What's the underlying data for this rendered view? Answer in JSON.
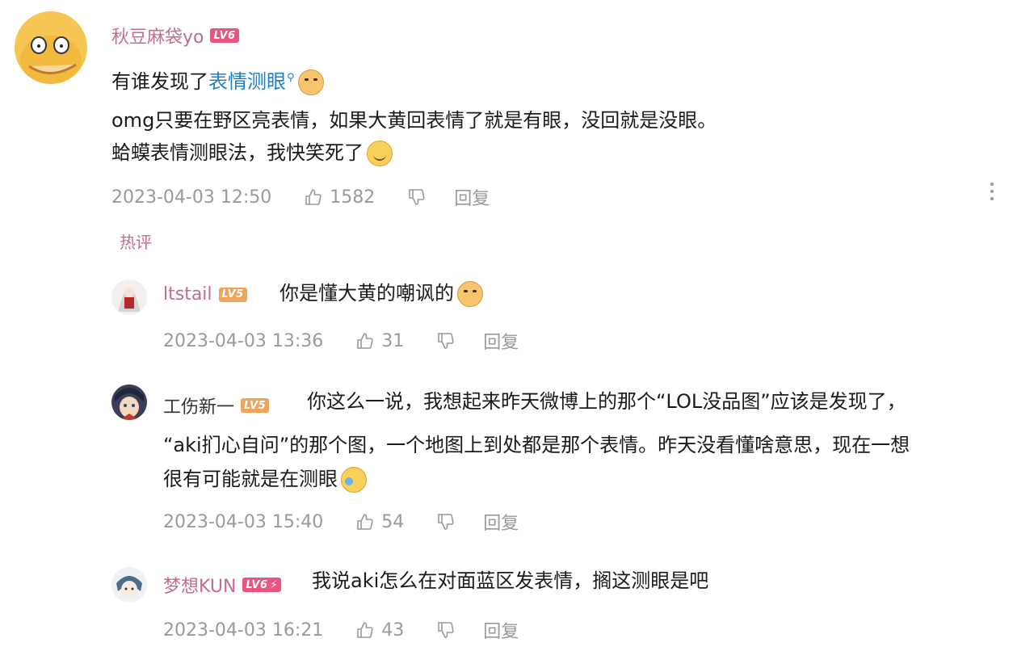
{
  "main_comment": {
    "username": "秋豆麻袋yo",
    "level": "LV6",
    "line1_prefix": "有谁发现了",
    "line1_link": "表情测眼",
    "line2": "omg只要在野区亮表情，如果大黄回表情了就是有眼，没回就是没眼。",
    "line3": "蛤蟆表情测眼法，我快笑死了",
    "timestamp": "2023-04-03 12:50",
    "likes": "1582",
    "reply_label": "回复"
  },
  "section_label": "热评",
  "replies": [
    {
      "username": "ltstail",
      "level": "LV5",
      "text": "你是懂大黄的嘲讽的",
      "timestamp": "2023-04-03 13:36",
      "likes": "31",
      "reply_label": "回复"
    },
    {
      "username": "工伤新一",
      "level": "LV5",
      "text_line1": "你这么一说，我想起来昨天微博上的那个“LOL没品图”应该是发现了，",
      "text_line2": "“aki扪心自问”的那个图，一个地图上到处都是那个表情。昨天没看懂啥意思，现在一想",
      "text_line3": "很有可能就是在测眼",
      "timestamp": "2023-04-03 15:40",
      "likes": "54",
      "reply_label": "回复"
    },
    {
      "username": "梦想KUN",
      "level": "LV6",
      "text": "我说aki怎么在对面蓝区发表情，搁这测眼是吧",
      "timestamp": "2023-04-03 16:21",
      "likes": "43",
      "reply_label": "回复"
    }
  ],
  "colors": {
    "username_pink": "#c46c8f",
    "link_blue": "#1e7ec8",
    "meta_gray": "#9a9a9a",
    "lv6_badge": "#e8557e",
    "lv5_badge": "#f0a35a"
  },
  "icons": {
    "like": "thumbs-up-icon",
    "dislike": "thumbs-down-icon",
    "more": "more-vertical-icon",
    "search": "search-icon"
  }
}
